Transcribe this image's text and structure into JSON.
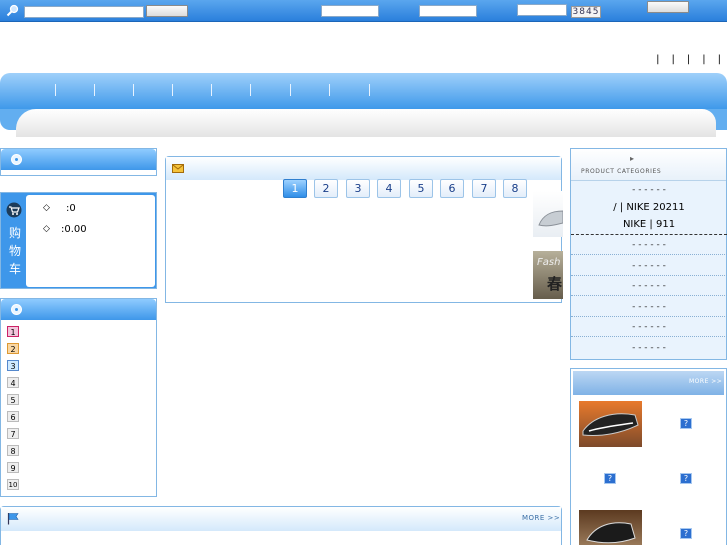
{
  "top": {
    "captcha": "3845"
  },
  "links": [
    "|",
    "|",
    "|",
    "|",
    "|"
  ],
  "cart": {
    "side_label": [
      "购",
      "物",
      "车"
    ],
    "items_line": ":0",
    "amount_line": ":0.00",
    "bullet": "◇"
  },
  "ranking": [
    "1",
    "2",
    "3",
    "4",
    "5",
    "6",
    "7",
    "8",
    "9",
    "10"
  ],
  "pagination": [
    "1",
    "2",
    "3",
    "4",
    "5",
    "6",
    "7",
    "8"
  ],
  "thumb_text": {
    "a": "Fash",
    "b": "春"
  },
  "categories": {
    "header_text": "PRODUCT CATEGORIES",
    "arrow": "▸",
    "items": [
      "- - -        - - -",
      "/   |  NIKE 20211",
      "NIKE   |     911",
      "- - -        - - -",
      "- - -          - - -",
      "- - -            - - -",
      "- - -           - - -",
      "- - -             - - -",
      "- - -           - - -"
    ]
  },
  "more_label": "MORE >>",
  "q": "?",
  "colors": {
    "accent": "#3e97ea",
    "nav_light": "#9fd0fa",
    "link": "#1a3f8a"
  }
}
